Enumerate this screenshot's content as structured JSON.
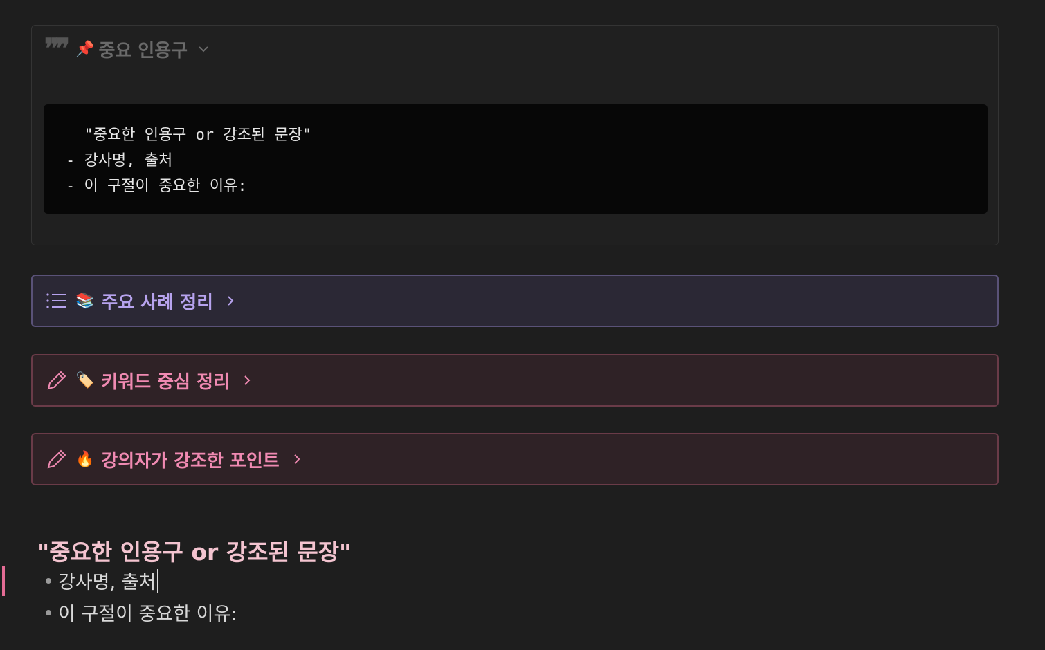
{
  "quote_callout": {
    "header_label": "중요 인용구",
    "pin_icon": "pushpin-icon",
    "code_lines": [
      "  \"중요한 인용구 or 강조된 문장\"",
      "- 강사명, 출처",
      "- 이 구절이 중요한 이유:"
    ]
  },
  "toggles": [
    {
      "label": "주요 사례 정리",
      "emoji": "📚",
      "color": "#b7a3ee"
    },
    {
      "label": "키워드 중심 정리",
      "emoji": "🏷️",
      "color": "#f08ab2"
    },
    {
      "label": "강의자가 강조한 포인트",
      "emoji": "🔥",
      "color": "#f08ab2"
    }
  ],
  "body": {
    "title": "\"중요한 인용구 or 강조된 문장\"",
    "bullets": [
      "강사명, 출처",
      "이 구절이 중요한 이유:"
    ]
  }
}
